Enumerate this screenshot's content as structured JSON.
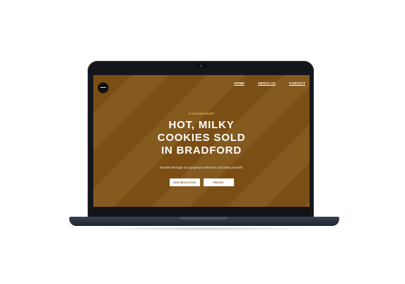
{
  "nav": {
    "items": [
      "HOME",
      "ABOUT US",
      "CONTACT"
    ]
  },
  "hero": {
    "eyebrow": "COOKIESHOP",
    "headline_lines": [
      "HOT, MILKY",
      "COOKIES SOLD",
      "IN BRADFORD"
    ],
    "subtitle": "Browse through our gorgeous selection and treat yourself.",
    "buttons": [
      "OUR SELECTION",
      "PRICES"
    ]
  },
  "colors": {
    "stripe_dark": "#7a4e14",
    "stripe_light": "#845a1f",
    "accent": "#e6b45a",
    "button_bg": "#ffffff",
    "laptop_body": "#14161b"
  }
}
